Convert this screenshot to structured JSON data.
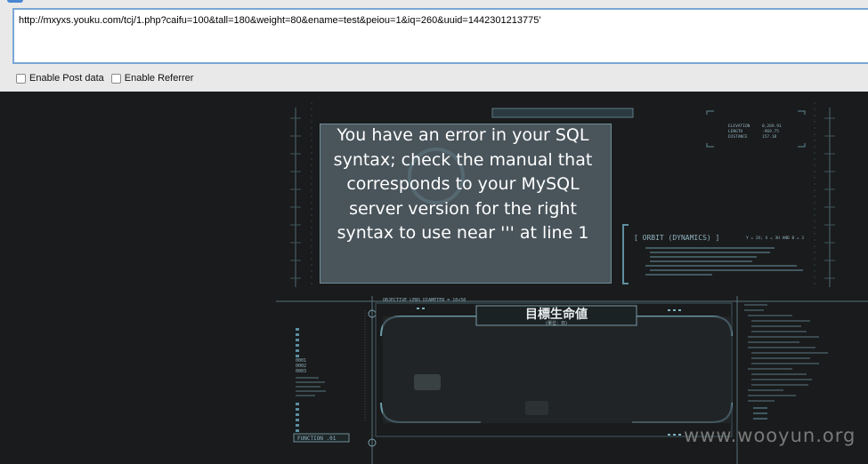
{
  "address_bar": {
    "url": "http://mxyxs.youku.com/tcj/1.php?caifu=100&tall=180&weight=80&ename=test&peiou=1&iq=260&uuid=1442301213775'"
  },
  "options": {
    "enable_post_data": "Enable Post data",
    "enable_referrer": "Enable Referrer"
  },
  "error": {
    "line1": "You have an error in your SQL",
    "line2": "syntax; check the manual that",
    "line3": "corresponds to your MySQL",
    "line4": "server version for the right",
    "line5": "syntax to use near ''' at line 1"
  },
  "hud": {
    "elevation_label": "ELEVATION",
    "elevation_value": "0,269.91",
    "length_label": "LENGTH",
    "length_value": "-969.75",
    "distance_label": "DISTANCE",
    "distance_value": "157.18",
    "orbit_title": "[ ORBIT (DYNAMICS) ]",
    "orbit_formula": "Y = 2X; X = 3H AND B = 3",
    "lens_label": "OBJECTIVE LENS DIAMETER = 10×50",
    "cn_title": "目標生命値",
    "cn_subtitle": "(單位：日)",
    "function_label": "FUNCTION .01",
    "codes": [
      "0001",
      "0002",
      "0003"
    ]
  },
  "watermark": "www.wooyun.org"
}
